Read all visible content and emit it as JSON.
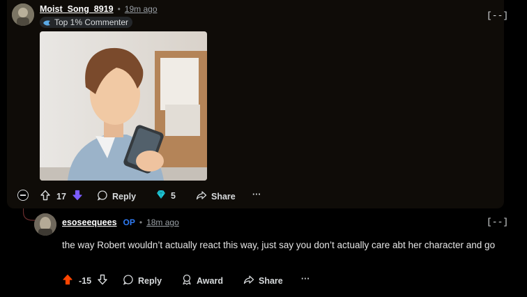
{
  "comment1": {
    "username": "Moist_Song_8919",
    "separator": "•",
    "time": "19m ago",
    "flair": "Top 1% Commenter",
    "collapse": "[--]",
    "actions": {
      "votes": "17",
      "reply": "Reply",
      "gems": "5",
      "share": "Share",
      "more": "···"
    },
    "colors": {
      "downvote": "#7b5cff",
      "gem": "#20c9d8"
    }
  },
  "comment2": {
    "username": "esoseequees",
    "op_badge": "OP",
    "separator": "•",
    "time": "18m ago",
    "collapse": "[--]",
    "body": "the way Robert wouldn’t actually react this way, just say you don’t actually care abt her character and go",
    "actions": {
      "votes": "-15",
      "reply": "Reply",
      "award": "Award",
      "share": "Share",
      "more": "···"
    },
    "colors": {
      "upvote": "#ff4500"
    }
  },
  "collapse_thread_icon": "minus-circle"
}
